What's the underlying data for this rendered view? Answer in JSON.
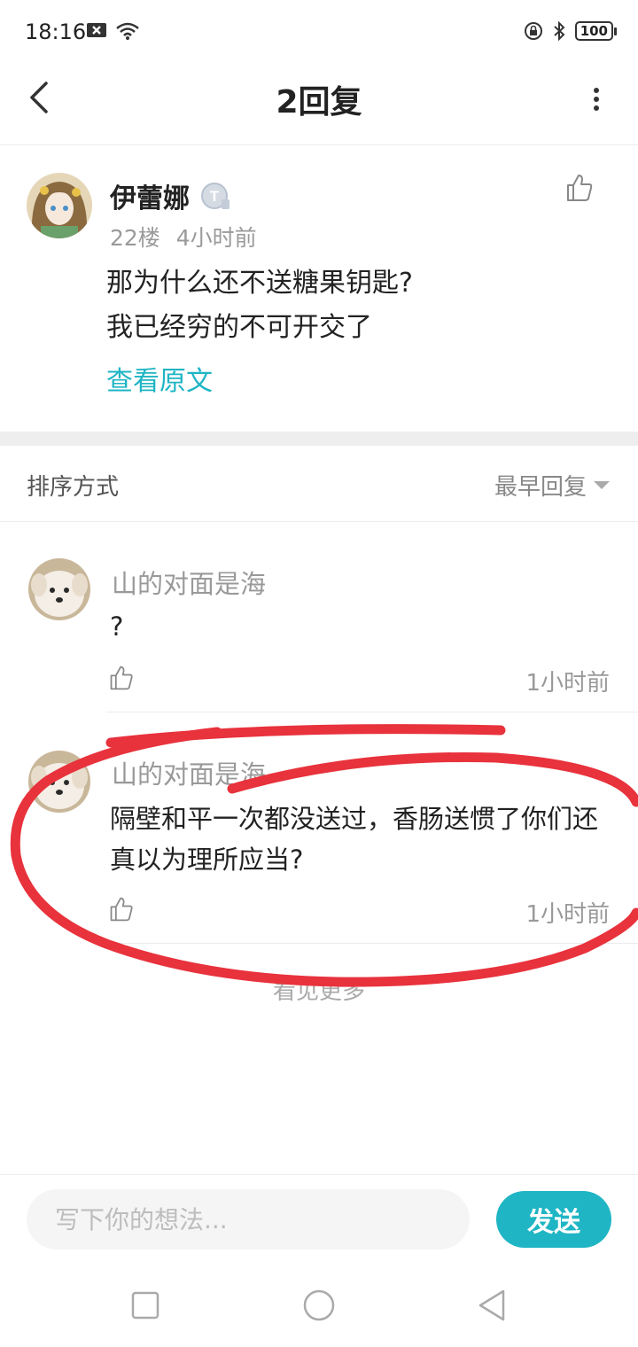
{
  "status_bar": {
    "time": "18:16",
    "battery": "100",
    "icons": [
      "notification-x-icon",
      "wifi-icon",
      "lock-rotation-icon",
      "bluetooth-icon",
      "battery-icon"
    ]
  },
  "header": {
    "title": "2回复",
    "back_icon": "back-arrow-icon",
    "more_icon": "more-vertical-icon"
  },
  "post": {
    "author": "伊蕾娜",
    "badge": "T",
    "floor": "22楼",
    "time": "4小时前",
    "lines": [
      "那为什么还不送糖果钥匙?",
      "我已经穷的不可开交了"
    ],
    "view_original": "查看原文"
  },
  "sort": {
    "label": "排序方式",
    "value": "最早回复"
  },
  "replies": [
    {
      "name": "山的对面是海",
      "text": "?",
      "time": "1小时前"
    },
    {
      "name": "山的对面是海",
      "text": "隔壁和平一次都没送过，香肠送惯了你们还真以为理所应当?",
      "time": "1小时前"
    }
  ],
  "view_more": "看见更多",
  "input": {
    "placeholder": "写下你的想法...",
    "send_label": "发送"
  },
  "colors": {
    "accent": "#1fb5c4",
    "annotation_red": "#e8323c"
  }
}
